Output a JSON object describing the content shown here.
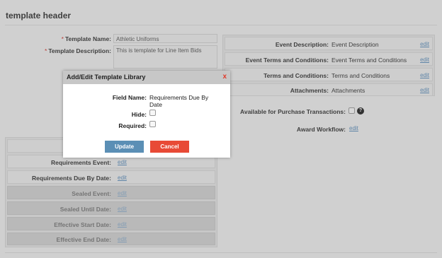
{
  "page": {
    "title": "template header"
  },
  "form": {
    "template_name_label": "Template Name:",
    "template_name_value": "Athletic Uniforms",
    "template_description_label": "Template Description:",
    "template_description_value": "This is template for Line Item Bids",
    "required_marker": "*"
  },
  "right_panel": {
    "rows": [
      {
        "label": "Event Description:",
        "value": "Event Description",
        "link": "edit"
      },
      {
        "label": "Event Terms and Conditions:",
        "value": "Event Terms and Conditions",
        "link": "edit"
      },
      {
        "label": "Terms and Conditions:",
        "value": "Terms and Conditions",
        "link": "edit"
      },
      {
        "label": "Attachments:",
        "value": "Attachments",
        "link": "edit"
      }
    ],
    "available_label": "Available for Purchase Transactions:",
    "help_icon_glyph": "?",
    "award_workflow_label": "Award Workflow:",
    "award_workflow_link": "edit"
  },
  "left_panel": {
    "rows": [
      {
        "label": "Requirements Event:",
        "link": "edit"
      },
      {
        "label": "Requirements Due By Date:",
        "link": "edit"
      },
      {
        "label": "Sealed Event:",
        "link": "edit"
      },
      {
        "label": "Sealed Until Date:",
        "link": "edit"
      },
      {
        "label": "Effective Start Date:",
        "link": "edit"
      },
      {
        "label": "Effective End Date:",
        "link": "edit"
      }
    ]
  },
  "modal": {
    "title": "Add/Edit Template Library",
    "close_glyph": "x",
    "field_name_label": "Field Name:",
    "field_name_value_line1": "Requirements Due By",
    "field_name_value_line2": "Date",
    "hide_label": "Hide:",
    "required_label": "Required:",
    "update_label": "Update",
    "cancel_label": "Cancel",
    "colors": {
      "update": "#5b8fb5",
      "cancel": "#e84a36",
      "close": "#e03a2a"
    }
  }
}
